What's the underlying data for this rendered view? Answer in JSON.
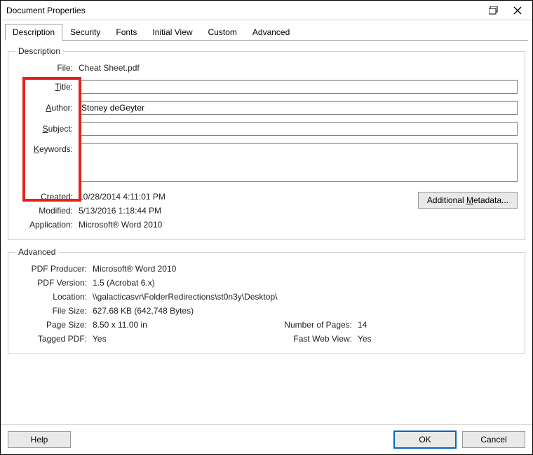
{
  "window": {
    "title": "Document Properties"
  },
  "tabs": [
    {
      "label": "Description",
      "active": true
    },
    {
      "label": "Security"
    },
    {
      "label": "Fonts"
    },
    {
      "label": "Initial View"
    },
    {
      "label": "Custom"
    },
    {
      "label": "Advanced"
    }
  ],
  "description": {
    "legend": "Description",
    "file_label": "File:",
    "file_value": "Cheat Sheet.pdf",
    "title_label_pre": "",
    "title_underline": "T",
    "title_label_post": "itle:",
    "title_value": "",
    "author_label_pre": "",
    "author_underline": "A",
    "author_label_post": "uthor:",
    "author_value": "Stoney deGeyter",
    "subject_label_pre": "",
    "subject_underline": "S",
    "subject_label_post": "ubject:",
    "subject_value": "",
    "keywords_label_pre": "",
    "keywords_underline": "K",
    "keywords_label_post": "eywords:",
    "keywords_value": "",
    "created_label": "Created:",
    "created_value": "10/28/2014 4:11:01 PM",
    "modified_label": "Modified:",
    "modified_value": "5/13/2016 1:18:44 PM",
    "application_label": "Application:",
    "application_value": "Microsoft® Word 2010",
    "addmeta_pre": "Additional ",
    "addmeta_underline": "M",
    "addmeta_post": "etadata..."
  },
  "advanced": {
    "legend": "Advanced",
    "producer_label": "PDF Producer:",
    "producer_value": "Microsoft® Word 2010",
    "version_label": "PDF Version:",
    "version_value": "1.5 (Acrobat 6.x)",
    "location_label": "Location:",
    "location_value": "\\\\galacticasvr\\FolderRedirections\\st0n3y\\Desktop\\",
    "filesize_label": "File Size:",
    "filesize_value": "627.68 KB (642,748 Bytes)",
    "pagesize_label": "Page Size:",
    "pagesize_value": "8.50 x 11.00 in",
    "numpages_label": "Number of Pages:",
    "numpages_value": "14",
    "tagged_label": "Tagged PDF:",
    "tagged_value": "Yes",
    "fastweb_label": "Fast Web View:",
    "fastweb_value": "Yes"
  },
  "footer": {
    "help": "Help",
    "ok": "OK",
    "cancel": "Cancel"
  }
}
